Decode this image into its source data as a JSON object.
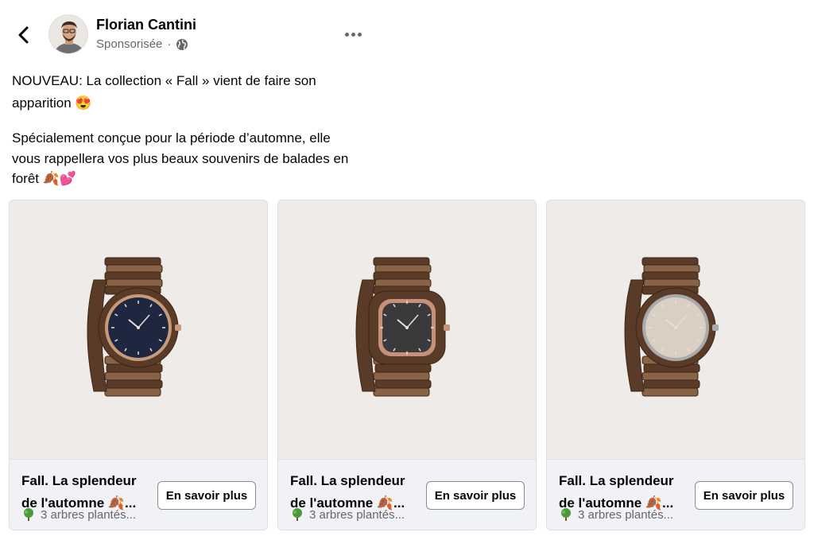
{
  "post": {
    "author": "Florian Cantini",
    "sponsored_label": "Sponsorisée",
    "separator": "·",
    "text_line1": "NOUVEAU: La collection « Fall » vient de faire son apparition 😍",
    "text_line2": "Spécialement conçue pour la période d’automne, elle vous rappellera vos plus beaux souvenirs de balades en forêt 🍂💕"
  },
  "icons": {
    "back": "chevron-left-icon",
    "globe": "globe-icon",
    "more": "more-horizontal-icon",
    "tree": "tree-icon"
  },
  "cards": [
    {
      "title_line1": "Fall. La splendeur",
      "title_line2": "de l'automne 🍂...",
      "subtitle": "3 arbres plantés...",
      "button": "En savoir plus",
      "watch_dial": "#1e2640",
      "watch_case": "#c79a7a",
      "watch_shape": "round"
    },
    {
      "title_line1": "Fall. La splendeur",
      "title_line2": "de l'automne 🍂...",
      "subtitle": "3 arbres plantés...",
      "button": "En savoir plus",
      "watch_dial": "#3a3a3c",
      "watch_case": "#c6917a",
      "watch_shape": "square"
    },
    {
      "title_line1": "Fall. La splendeur",
      "title_line2": "de l'automne 🍂...",
      "subtitle": "3 arbres plantés...",
      "button": "En savoir plus",
      "watch_dial": "#d9cfc2",
      "watch_case": "#a9aaac",
      "watch_shape": "round"
    }
  ],
  "colors": {
    "text_primary": "#050505",
    "text_secondary": "#65676b",
    "card_footer_bg": "#f0f2f5",
    "image_bg": "#eeebe8",
    "wood_dark": "#5a3b27",
    "wood_light": "#8a6346"
  }
}
